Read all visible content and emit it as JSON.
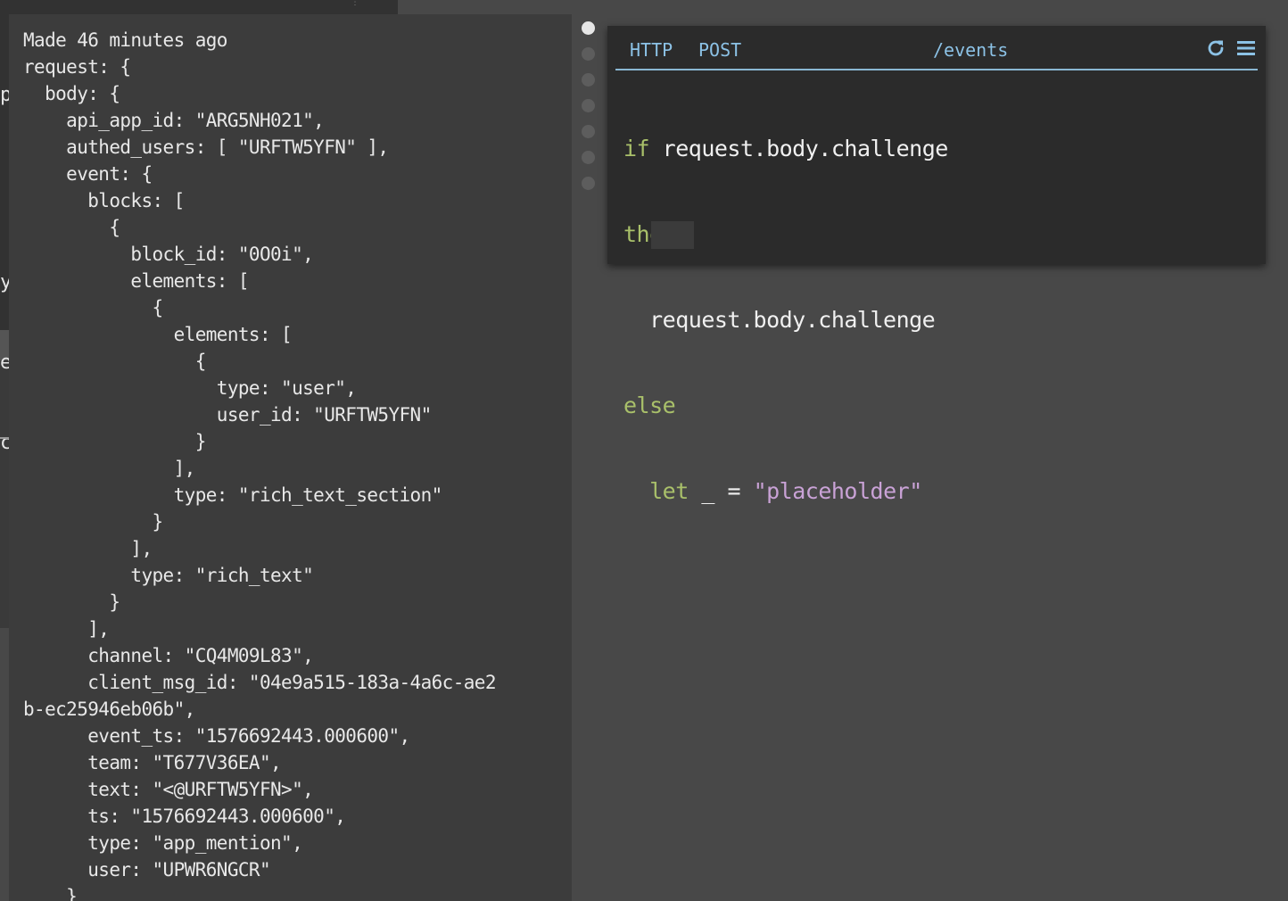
{
  "request_viewer": {
    "header": "Made 46 minutes ago",
    "lines": [
      "request: {",
      "  body: {",
      "    api_app_id: \"ARG5NH021\",",
      "    authed_users: [ \"URFTW5YFN\" ],",
      "    event: {",
      "      blocks: [",
      "        {",
      "          block_id: \"0O0i\",",
      "          elements: [",
      "            {",
      "              elements: [",
      "                {",
      "                  type: \"user\",",
      "                  user_id: \"URFTW5YFN\"",
      "                }",
      "              ],",
      "              type: \"rich_text_section\"",
      "            }",
      "          ],",
      "          type: \"rich_text\"",
      "        }",
      "      ],",
      "      channel: \"CQ4M09L83\",",
      "      client_msg_id: \"04e9a515-183a-4a6c-ae2",
      "b-ec25946eb06b\",",
      "      event_ts: \"1576692443.000600\",",
      "      team: \"T677V36EA\",",
      "      text: \"<@URFTW5YFN>\",",
      "      ts: \"1576692443.000600\",",
      "      type: \"app_mention\",",
      "      user: \"UPWR6NGCR\"",
      "    }"
    ]
  },
  "background_fragments": [
    "p",
    "",
    "",
    "y",
    "e",
    "c"
  ],
  "history": {
    "count": 7,
    "active_index": 0
  },
  "handler": {
    "kind": "HTTP",
    "method": "POST",
    "route": "/events",
    "icons": [
      "refresh-icon",
      "hamburger-menu-icon"
    ],
    "code": {
      "if_kw": "if",
      "condition": "request.body.challenge",
      "then_kw": "then",
      "then_expr": "request.body.challenge",
      "else_kw": "else",
      "let_kw": "let",
      "let_name": "_",
      "let_eq": "=",
      "let_value": "\"placeholder\""
    }
  },
  "colors": {
    "keyword": "#a9c06a",
    "string": "#c9a2d6",
    "header_accent": "#8cc2e6"
  }
}
